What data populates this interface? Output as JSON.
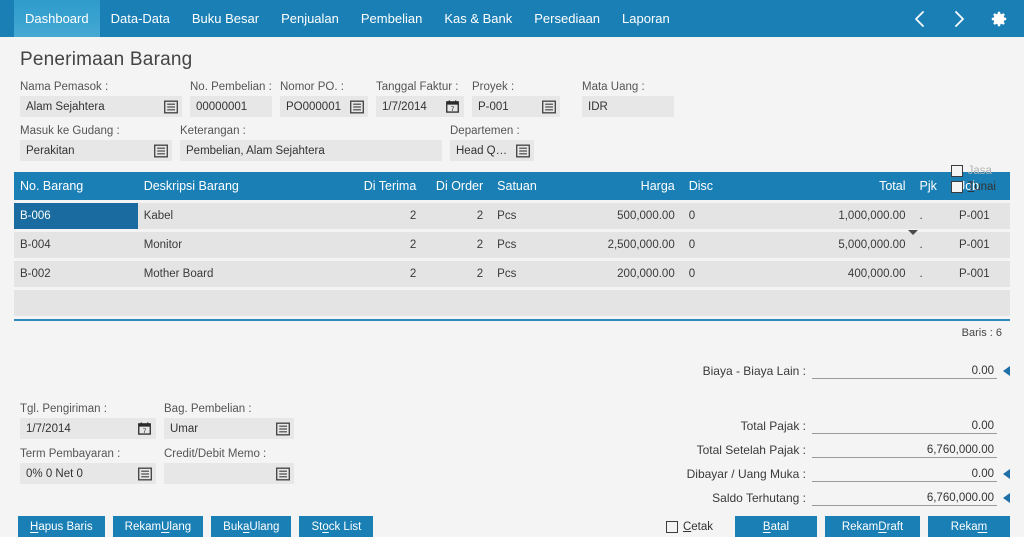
{
  "nav": {
    "items": [
      {
        "label": "Dashboard",
        "active": true
      },
      {
        "label": "Data-Data",
        "active": false
      },
      {
        "label": "Buku Besar",
        "active": false
      },
      {
        "label": "Penjualan",
        "active": false
      },
      {
        "label": "Pembelian",
        "active": false
      },
      {
        "label": "Kas & Bank",
        "active": false
      },
      {
        "label": "Persediaan",
        "active": false
      },
      {
        "label": "Laporan",
        "active": false
      }
    ],
    "prev_icon": "chevron-left-icon",
    "next_icon": "chevron-right-icon",
    "settings_icon": "gear-icon",
    "bar_color": "#1a7fb5",
    "active_tab_color": "#3aa2d0"
  },
  "page": {
    "title": "Penerimaan Barang"
  },
  "header_fields": {
    "nama_pemasok": {
      "label": "Nama Pemasok :",
      "value": "Alam Sejahtera"
    },
    "no_pembelian": {
      "label": "No. Pembelian :",
      "value": "00000001"
    },
    "nomor_po": {
      "label": "Nomor PO. :",
      "value": "PO000001"
    },
    "tanggal_faktur": {
      "label": "Tanggal Faktur :",
      "value": "1/7/2014"
    },
    "proyek": {
      "label": "Proyek :",
      "value": "P-001"
    },
    "mata_uang": {
      "label": "Mata Uang :",
      "value": "IDR"
    },
    "masuk_ke_gudang": {
      "label": "Masuk ke Gudang :",
      "value": "Perakitan"
    },
    "keterangan": {
      "label": "Keterangan :",
      "value": "Pembelian, Alam Sejahtera"
    },
    "departemen": {
      "label": "Departemen :",
      "value": "Head Quarte"
    }
  },
  "checkboxes": {
    "jasa": {
      "label": "Jasa",
      "checked": false,
      "disabled": true
    },
    "tunai": {
      "label": "Tunai",
      "checked": false,
      "disabled": false,
      "accel": "T"
    }
  },
  "grid": {
    "columns": [
      "No. Barang",
      "Deskripsi Barang",
      "Di Terima",
      "Di Order",
      "Satuan",
      "Harga",
      "Disc",
      "Total",
      "Pjk",
      "Job"
    ],
    "rows": [
      {
        "no_barang": "B-006",
        "deskripsi": "Kabel",
        "di_terima": "2",
        "di_order": "2",
        "satuan": "Pcs",
        "harga": "500,000.00",
        "disc": "0",
        "total": "1,000,000.00",
        "pjk": ".",
        "job": "P-001",
        "selected": true
      },
      {
        "no_barang": "B-004",
        "deskripsi": "Monitor",
        "di_terima": "2",
        "di_order": "2",
        "satuan": "Pcs",
        "harga": "2,500,000.00",
        "disc": "0",
        "total": "5,000,000.00",
        "pjk": ".",
        "job": "P-001",
        "selected": false
      },
      {
        "no_barang": "B-002",
        "deskripsi": "Mother Board",
        "di_terima": "2",
        "di_order": "2",
        "satuan": "Pcs",
        "harga": "200,000.00",
        "disc": "0",
        "total": "400,000.00",
        "pjk": ".",
        "job": "P-001",
        "selected": false
      }
    ],
    "row_count_label": "Baris : 6"
  },
  "totals": {
    "biaya_lain": {
      "label": "Biaya - Biaya Lain :",
      "value": "0.00",
      "has_arrow": true
    },
    "total_pajak": {
      "label": "Total Pajak :",
      "value": "0.00",
      "has_arrow": false
    },
    "total_setelah_pajak": {
      "label": "Total Setelah Pajak :",
      "value": "6,760,000.00",
      "has_arrow": false
    },
    "dibayar": {
      "label": "Dibayar / Uang Muka :",
      "value": "0.00",
      "has_arrow": true
    },
    "saldo_terhutang": {
      "label": "Saldo Terhutang :",
      "value": "6,760,000.00",
      "has_arrow": true
    }
  },
  "bottom_fields": {
    "tgl_pengiriman": {
      "label": "Tgl. Pengiriman :",
      "value": "1/7/2014"
    },
    "bag_pembelian": {
      "label": "Bag. Pembelian :",
      "value": "Umar"
    },
    "term_pembayaran": {
      "label": "Term Pembayaran :",
      "value": "0% 0 Net 0"
    },
    "credit_debit_memo": {
      "label": "Credit/Debit Memo :",
      "value": ""
    }
  },
  "buttons": {
    "hapus_baris": {
      "pre": "",
      "accel": "H",
      "post": "apus Baris"
    },
    "rekam_ulang": {
      "pre": "Rekam ",
      "accel": "U",
      "post": "lang"
    },
    "buka_ulang": {
      "pre": "Buk",
      "accel": "a",
      "post": " Ulang"
    },
    "stock_list": {
      "pre": "St",
      "accel": "o",
      "post": "ck List"
    },
    "batal": {
      "pre": "",
      "accel": "B",
      "post": "atal"
    },
    "rekam_draft": {
      "pre": "Rekam ",
      "accel": "D",
      "post": "raft"
    },
    "rekam": {
      "pre": "Reka",
      "accel": "m",
      "post": ""
    }
  },
  "cetak": {
    "label_pre": "",
    "accel": "C",
    "label_post": "etak",
    "checked": false
  }
}
